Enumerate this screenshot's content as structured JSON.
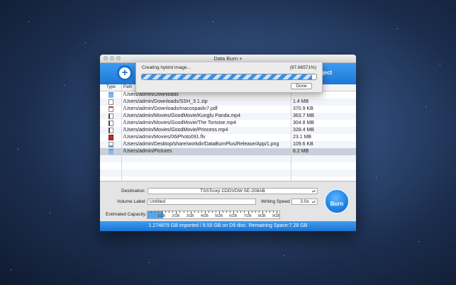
{
  "window": {
    "title": "Data Burn +"
  },
  "toolbar": {
    "eject_label": "Eject"
  },
  "table": {
    "headers": {
      "type": "Type",
      "path": "Path"
    },
    "rows": [
      {
        "icon": "folder-icon",
        "path": "/Users/admin/Downloads",
        "size": ""
      },
      {
        "icon": "document-icon",
        "path": "/Users/admin/Downloads/SSH_3.1.zip",
        "size": "1.4 MB"
      },
      {
        "icon": "pdf-icon",
        "path": "/Users/admin/Downloads/macospaidv7.pdf",
        "size": "370.9 KB"
      },
      {
        "icon": "video-icon",
        "path": "/Users/admin/Movies/GoodMovie/Kungfu Panda.mp4",
        "size": "363.7 MB"
      },
      {
        "icon": "video-icon",
        "path": "/Users/admin/Movies/GoodMovie/The Tortoise.mp4",
        "size": "304.8 MB"
      },
      {
        "icon": "video-icon",
        "path": "/Users/admin/Movies/GoodMovie/Princess.mp4",
        "size": "328.4 MB"
      },
      {
        "icon": "flash-video-icon",
        "path": "/Users/admin/Movies/06iPhoto091.flv",
        "size": "23.1 MB"
      },
      {
        "icon": "image-icon",
        "path": "/Users/admin/Desktop/share/workdir/DataBurnPlus/Release/App/1.png",
        "size": "109.6 KB"
      },
      {
        "icon": "folder-icon",
        "path": "/Users/admin/Pictures",
        "size": "6.2 MB"
      }
    ]
  },
  "bottom": {
    "destination_label": "Destination:",
    "destination_value": "TSSTcorp CDDVDW SE-208AB",
    "volume_label": "Volume Label:",
    "volume_value": "Untitled",
    "writing_speed_label": "Writing Speed",
    "writing_speed_value": "3.0x",
    "capacity_label": "Estimated Capacity:",
    "capacity_ticks": [
      "1GB",
      "2GB",
      "3GB",
      "4GB",
      "5GB",
      "6GB",
      "7GB",
      "8GB",
      "9GB"
    ],
    "capacity_fill_fraction": 0.12,
    "burn_label": "Burn"
  },
  "status": {
    "text": "1.274879 GB imported / 8.55 GB on D9 disc. Remaining Space:7.28 GB"
  },
  "sheet": {
    "title": "Creating hybrid image...",
    "percent": "(97.66571%)",
    "progress_fraction": 0.9766571,
    "done_label": "Done"
  },
  "colors": {
    "accent": "#2a87e6",
    "selection": "#c9cfd8",
    "status_bar": "#2a87e6"
  }
}
